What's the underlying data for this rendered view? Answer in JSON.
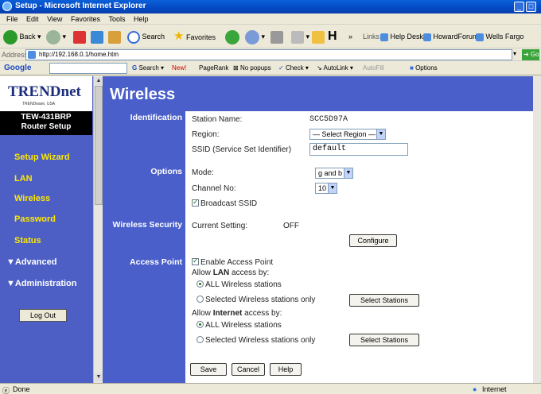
{
  "window": {
    "title": "Setup - Microsoft Internet Explorer"
  },
  "menu": [
    "File",
    "Edit",
    "View",
    "Favorites",
    "Tools",
    "Help"
  ],
  "toolbar": {
    "back": "Back",
    "search": "Search",
    "favorites": "Favorites",
    "links_label": "Links",
    "links": [
      "Help Desk",
      "HowardForums",
      "Wells Fargo"
    ]
  },
  "address": {
    "label": "Address",
    "url": "http://192.168.0.1/home.htm",
    "go": "Go"
  },
  "google": {
    "logo": "Google",
    "search": "Search",
    "pagerank": "PageRank",
    "popups": "No popups",
    "check": "Check",
    "autolink": "AutoLink",
    "autofill": "AutoFill",
    "options": "Options"
  },
  "sidebar": {
    "brand": "TRENDnet",
    "brand_sub": "TRENDware, USA",
    "model": "TEW-431BRP",
    "model_sub": "Router Setup",
    "items": [
      {
        "label": "Setup Wizard"
      },
      {
        "label": "LAN"
      },
      {
        "label": "Wireless"
      },
      {
        "label": "Password"
      },
      {
        "label": "Status"
      },
      {
        "label": "▼Advanced"
      },
      {
        "label": "▼Administration"
      }
    ],
    "logout": "Log Out"
  },
  "page": {
    "title": "Wireless",
    "identification_label": "Identification",
    "station_name_label": "Station Name:",
    "station_name_value": "SCC5D97A",
    "region_label": "Region:",
    "region_value": "— Select Region —",
    "ssid_label": "SSID (Service Set Identifier)",
    "ssid_value": "default",
    "options_label": "Options",
    "mode_label": "Mode:",
    "mode_value": "g and b",
    "channel_label": "Channel No:",
    "channel_value": "10",
    "broadcast_ssid": "Broadcast SSID",
    "wireless_security_label": "Wireless Security",
    "current_setting_label": "Current Setting:",
    "current_setting_value": "OFF",
    "configure": "Configure",
    "access_point_label": "Access Point",
    "enable_ap": "Enable Access Point",
    "allow_lan_pre": "Allow ",
    "allow_lan_bold": "LAN",
    "allow_lan_post": " access by:",
    "all_wireless": "ALL Wireless stations",
    "selected_wireless": "Selected Wireless stations only",
    "select_stations": "Select Stations",
    "allow_inet_pre": "Allow ",
    "allow_inet_bold": "Internet",
    "allow_inet_post": " access by:",
    "save": "Save",
    "cancel": "Cancel",
    "help": "Help"
  },
  "status": {
    "left": "Done",
    "right": "Internet"
  }
}
